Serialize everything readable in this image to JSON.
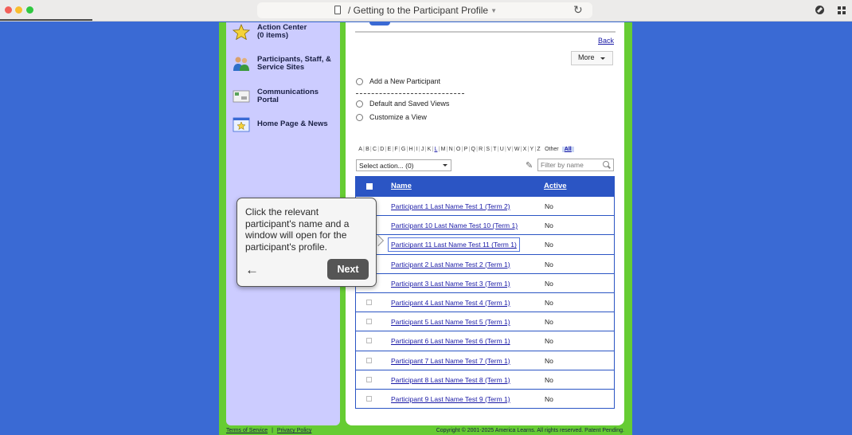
{
  "browser": {
    "url_title": "/ Getting to the Participant Profile"
  },
  "sidebar": {
    "items": [
      {
        "label_line1": "Action Center",
        "label_line2": "(0 items)",
        "icon": "star-icon"
      },
      {
        "label_line1": "Participants, Staff, &",
        "label_line2": "Service Sites",
        "icon": "people-icon"
      },
      {
        "label_line1": "Communications",
        "label_line2": "Portal",
        "icon": "envelope-icon"
      },
      {
        "label_line1": "Home Page & News",
        "label_line2": "",
        "icon": "home-page-icon"
      }
    ]
  },
  "content": {
    "back_label": "Back",
    "more_label": "More",
    "options": {
      "add_new": "Add a New Participant",
      "saved_views": "Default and Saved Views",
      "customize": "Customize a View"
    },
    "alphabet": [
      "A",
      "B",
      "C",
      "D",
      "E",
      "F",
      "G",
      "H",
      "I",
      "J",
      "K",
      "L",
      "M",
      "N",
      "O",
      "P",
      "Q",
      "R",
      "S",
      "T",
      "U",
      "V",
      "W",
      "X",
      "Y",
      "Z"
    ],
    "alphabet_other": "Other",
    "alphabet_all": "All",
    "select_action": "Select action... (0)",
    "filter_placeholder": "Filter by name"
  },
  "table": {
    "columns": [
      "Name",
      "Active"
    ],
    "rows": [
      {
        "name": "Participant 1 Last Name Test 1 (Term 2)",
        "active": "No"
      },
      {
        "name": "Participant 10 Last Name Test 10 (Term 1)",
        "active": "No"
      },
      {
        "name": "Participant 11 Last Name Test 11 (Term 1)",
        "active": "No"
      },
      {
        "name": "Participant 2 Last Name Test 2 (Term 1)",
        "active": "No"
      },
      {
        "name": "Participant 3 Last Name Test 3 (Term 1)",
        "active": "No"
      },
      {
        "name": "Participant 4 Last Name Test 4 (Term 1)",
        "active": "No"
      },
      {
        "name": "Participant 5 Last Name Test 5 (Term 1)",
        "active": "No"
      },
      {
        "name": "Participant 6 Last Name Test 6 (Term 1)",
        "active": "No"
      },
      {
        "name": "Participant 7 Last Name Test 7 (Term 1)",
        "active": "No"
      },
      {
        "name": "Participant 8 Last Name Test 8 (Term 1)",
        "active": "No"
      },
      {
        "name": "Participant 9 Last Name Test 9 (Term 1)",
        "active": "No"
      }
    ]
  },
  "footer": {
    "terms": "Terms of Service",
    "separator": "|",
    "privacy": "Privacy Policy",
    "copyright": "Copyright © 2001-2025 America Learns. All rights reserved. Patent Pending."
  },
  "coachmark": {
    "text": "Click the relevant participant's name and a window will open for the participant's profile.",
    "next_label": "Next",
    "back_icon": "arrow-left-icon"
  }
}
